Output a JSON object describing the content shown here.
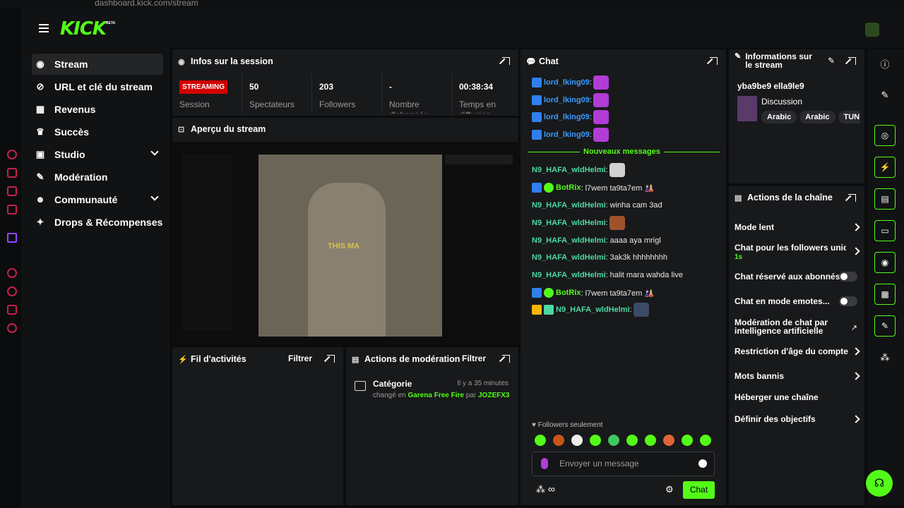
{
  "browser": {
    "url": "dashboard.kick.com/stream"
  },
  "header": {
    "logo": "KICK",
    "beta": "BETA"
  },
  "nav": {
    "items": [
      {
        "label": "Stream",
        "icon": "broadcast-icon"
      },
      {
        "label": "URL et clé du stream",
        "icon": "link-icon"
      },
      {
        "label": "Revenus",
        "icon": "chart-icon"
      },
      {
        "label": "Succès",
        "icon": "trophy-icon"
      },
      {
        "label": "Studio",
        "icon": "grid-icon"
      },
      {
        "label": "Modération",
        "icon": "wrench-icon"
      },
      {
        "label": "Communauté",
        "icon": "people-icon"
      },
      {
        "label": "Drops & Récompenses",
        "icon": "gift-icon"
      }
    ]
  },
  "session": {
    "title": "Infos sur la session",
    "status": "STREAMING",
    "status_label": "Session",
    "viewers": "50",
    "viewers_label": "Spectateurs",
    "followers": "203",
    "followers_label": "Followers",
    "subs": "-",
    "subs_label": "Nombre d'abonnés",
    "duration": "00:38:34",
    "duration_label": "Temps en diffusion"
  },
  "preview": {
    "title": "Aperçu du stream",
    "overlay": "THIS MA"
  },
  "activity": {
    "title": "Fil d'activités",
    "filter": "Filtrer"
  },
  "modactions": {
    "title": "Actions de modération",
    "filter": "Filtrer",
    "item_title": "Catégorie",
    "item_time": "Il y a 35 minutes",
    "item_prefix": "changé en",
    "item_category": "Garena Free Fire",
    "item_by": "par",
    "item_user": "JOZEFX3"
  },
  "chat": {
    "title": "Chat",
    "new_messages": "Nouveaux messages",
    "old_messages": [
      {
        "user": "lord_lking09"
      },
      {
        "user": "lord_lking09"
      },
      {
        "user": "lord_lking09"
      },
      {
        "user": "lord_lking09"
      }
    ],
    "messages": [
      {
        "user": "N9_HAFA_wldHelmi",
        "text": ":"
      },
      {
        "user": "BotRix",
        "text": ": l7wem ta9ta7em 🎎"
      },
      {
        "user": "N9_HAFA_wldHelmi",
        "text": ": winha cam 3ad"
      },
      {
        "user": "N9_HAFA_wldHelmi",
        "text": ":"
      },
      {
        "user": "N9_HAFA_wldHelmi",
        "text": ": aaaa aya mrigl"
      },
      {
        "user": "N9_HAFA_wldHelmi",
        "text": ": 3ak3k hhhhhhhh"
      },
      {
        "user": "N9_HAFA_wldHelmi",
        "text": ": halit mara wahda live"
      },
      {
        "user": "BotRix",
        "text": ": l7wem ta9ta7em 🎎"
      },
      {
        "user": "N9_HAFA_wldHelmi",
        "text": ":"
      }
    ],
    "followers_only": "Followers seulement",
    "placeholder": "Envoyer un message",
    "send": "Chat"
  },
  "streaminfo": {
    "title": "Informations sur le stream",
    "stream_title": "yba9be9 ella9le9",
    "category": "Discussion",
    "tags": [
      "Arabic",
      "Arabic",
      "TUN"
    ]
  },
  "channel": {
    "title": "Actions de la chaîne",
    "items": [
      "Mode lent",
      "Chat pour les followers uniqu",
      "Chat réservé aux abonnés",
      "Chat en mode emotes...",
      "Modération de chat par intelligence artificielle",
      "Restriction d'âge du compte",
      "Mots bannis",
      "Héberger une chaîne",
      "Définir des objectifs"
    ],
    "followers_sub": "1s"
  },
  "colors": {
    "accent": "#53fc18",
    "live": "#d10000",
    "bg": "#0b0c0d",
    "panel": "#18191b"
  }
}
